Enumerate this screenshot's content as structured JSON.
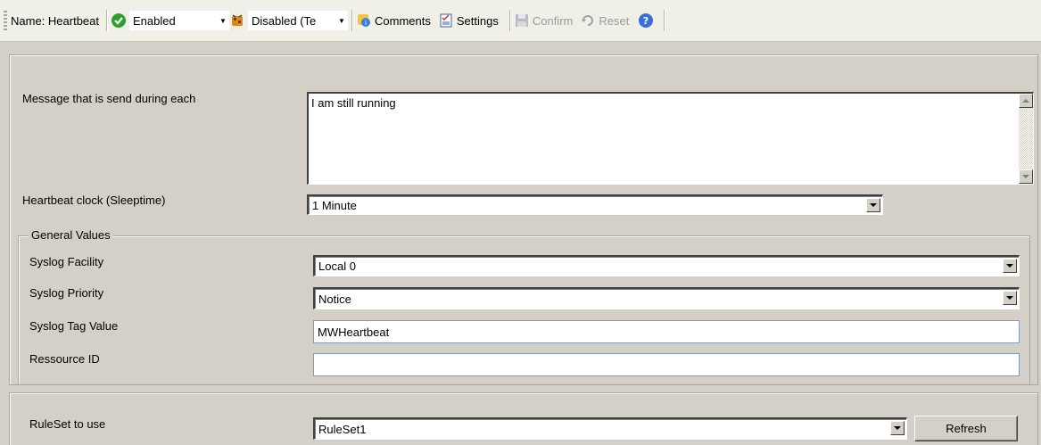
{
  "toolbar": {
    "name_label": "Name: Heartbeat",
    "status_value": "Enabled",
    "mode_value": "Disabled (Te",
    "comments_label": "Comments",
    "settings_label": "Settings",
    "confirm_label": "Confirm",
    "reset_label": "Reset"
  },
  "form": {
    "message_label": "Message that is send during each",
    "message_value": "I am still running",
    "clock_label": "Heartbeat clock (Sleeptime)",
    "clock_value": "1 Minute"
  },
  "general": {
    "title": "General Values",
    "facility_label": "Syslog Facility",
    "facility_value": "Local 0",
    "priority_label": "Syslog Priority",
    "priority_value": "Notice",
    "tag_label": "Syslog Tag Value",
    "tag_value": "MWHeartbeat",
    "resource_label": "Ressource ID",
    "resource_value": ""
  },
  "ruleset": {
    "label": "RuleSet to use",
    "value": "RuleSet1",
    "refresh_label": "Refresh"
  },
  "colors": {
    "enabled_green": "#2e9e2e",
    "help_blue": "#3a6fd8"
  }
}
